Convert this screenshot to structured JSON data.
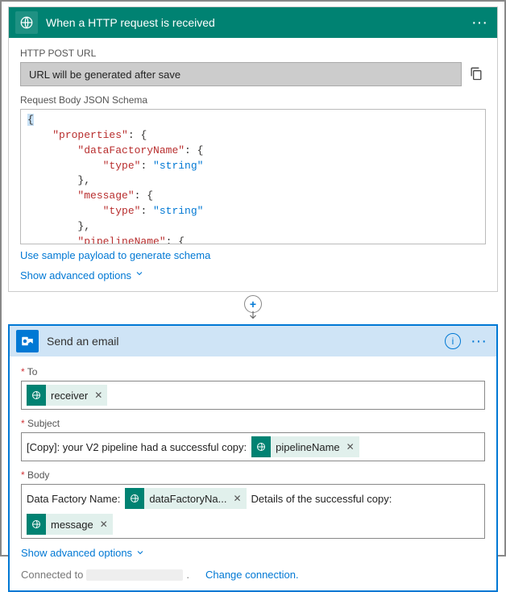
{
  "http_card": {
    "title": "When a HTTP request is received",
    "post_url_label": "HTTP POST URL",
    "post_url_value": "URL will be generated after save",
    "schema_label": "Request Body JSON Schema",
    "sample_link": "Use sample payload to generate schema",
    "advanced_link": "Show advanced options",
    "schema_tokens": [
      [
        "plain",
        "{"
      ],
      [
        "indent1-str",
        "\"properties\""
      ],
      [
        "plain",
        ": {"
      ],
      [
        "indent2-str",
        "\"dataFactoryName\""
      ],
      [
        "plain",
        ": {"
      ],
      [
        "indent3-str",
        "\"type\""
      ],
      [
        "plain",
        ": "
      ],
      [
        "kw",
        "\"string\""
      ],
      [
        "indent2-plain",
        "},"
      ],
      [
        "indent2-str",
        "\"message\""
      ],
      [
        "plain",
        ": {"
      ],
      [
        "indent3-str",
        "\"type\""
      ],
      [
        "plain",
        ": "
      ],
      [
        "kw",
        "\"string\""
      ],
      [
        "indent2-plain",
        "},"
      ],
      [
        "indent2-str",
        "\"pipelineName\""
      ],
      [
        "plain",
        ": {"
      ]
    ]
  },
  "email_card": {
    "title": "Send an email",
    "to_label": "To",
    "to_token": "receiver",
    "subject_label": "Subject",
    "subject_prefix": "[Copy]: your V2 pipeline had a successful copy:",
    "subject_token": "pipelineName",
    "body_label": "Body",
    "body_prefix": "Data Factory Name:",
    "body_token1": "dataFactoryNa...",
    "body_mid": "Details of the successful copy:",
    "body_token2": "message",
    "advanced_link": "Show advanced options",
    "connected_label": "Connected to",
    "change_conn": "Change connection."
  },
  "icons": {
    "globe": "globe-icon",
    "outlook": "outlook-icon"
  }
}
